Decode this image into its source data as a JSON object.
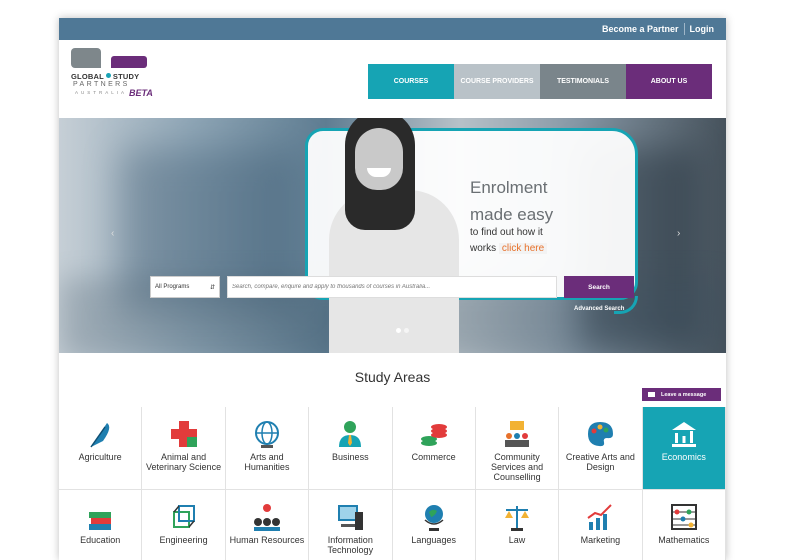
{
  "topbar": {
    "partner": "Become a Partner",
    "login": "Login"
  },
  "logo": {
    "line1a": "GLOBAL",
    "line1b": "STUDY",
    "line2": "PARTNERS",
    "line3": "AUSTRALIA",
    "beta": "BETA"
  },
  "nav": [
    {
      "label": "COURSES",
      "color": "#16a4b4"
    },
    {
      "label": "COURSE PROVIDERS",
      "color": "#b9c2c8"
    },
    {
      "label": "TESTIMONIALS",
      "color": "#7a858b"
    },
    {
      "label": "ABOUT US",
      "color": "#6b2d7a"
    }
  ],
  "hero": {
    "title1": "Enrolment",
    "title2": "made easy",
    "sub1": "to find out how it",
    "sub2": "works",
    "click": "click here",
    "prev_icon": "chevron-left-icon",
    "next_icon": "chevron-right-icon"
  },
  "search": {
    "select_value": "All Programs",
    "placeholder": "Search, compare, enquire and apply to thousands of courses in Australia...",
    "button": "Search",
    "advanced": "Advanced Search"
  },
  "study": {
    "title": "Study Areas",
    "leave_message": "Leave a message",
    "areas": [
      {
        "label": "Agriculture",
        "icon": "feather-icon"
      },
      {
        "label": "Animal and Veterinary Science",
        "icon": "medical-cross-icon"
      },
      {
        "label": "Arts and Humanities",
        "icon": "globe-icon"
      },
      {
        "label": "Business",
        "icon": "businessman-icon"
      },
      {
        "label": "Commerce",
        "icon": "coins-icon"
      },
      {
        "label": "Community Services and Counselling",
        "icon": "group-icon"
      },
      {
        "label": "Creative Arts and Design",
        "icon": "palette-icon"
      },
      {
        "label": "Economics",
        "icon": "bank-chart-icon",
        "active": true
      },
      {
        "label": "Education",
        "icon": "books-icon"
      },
      {
        "label": "Engineering",
        "icon": "cube-icon"
      },
      {
        "label": "Human Resources",
        "icon": "hierarchy-icon"
      },
      {
        "label": "Information Technology",
        "icon": "computer-icon"
      },
      {
        "label": "Languages",
        "icon": "globe-stand-icon"
      },
      {
        "label": "Law",
        "icon": "scales-icon"
      },
      {
        "label": "Marketing",
        "icon": "growth-chart-icon"
      },
      {
        "label": "Mathematics",
        "icon": "abacus-icon"
      }
    ]
  },
  "colors": {
    "teal": "#16a4b4",
    "purple": "#6b2d7a",
    "slate": "#4f7896",
    "orange": "#e7712b"
  }
}
